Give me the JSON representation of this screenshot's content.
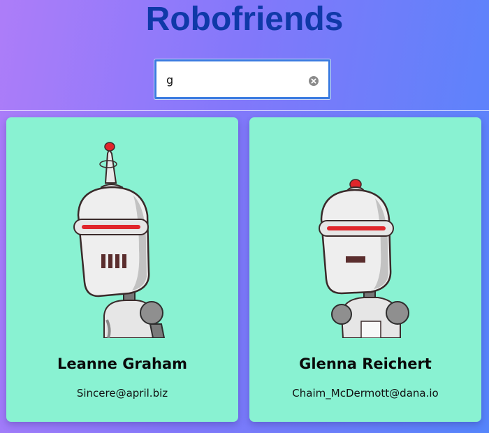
{
  "app": {
    "title": "Robofriends"
  },
  "search": {
    "value": "g",
    "clear_icon": "clear-circle-icon"
  },
  "robots": [
    {
      "name": "Leanne Graham",
      "email": "Sincere@april.biz",
      "avatar_icon": "robot-antenna-grille-avatar"
    },
    {
      "name": "Glenna Reichert",
      "email": "Chaim_McDermott@dana.io",
      "avatar_icon": "robot-dome-light-avatar"
    }
  ],
  "colors": {
    "title": "#0f39a8",
    "card_background": "#89f2d2",
    "search_border": "#3a7be0",
    "visor_red": "#e0252b"
  }
}
